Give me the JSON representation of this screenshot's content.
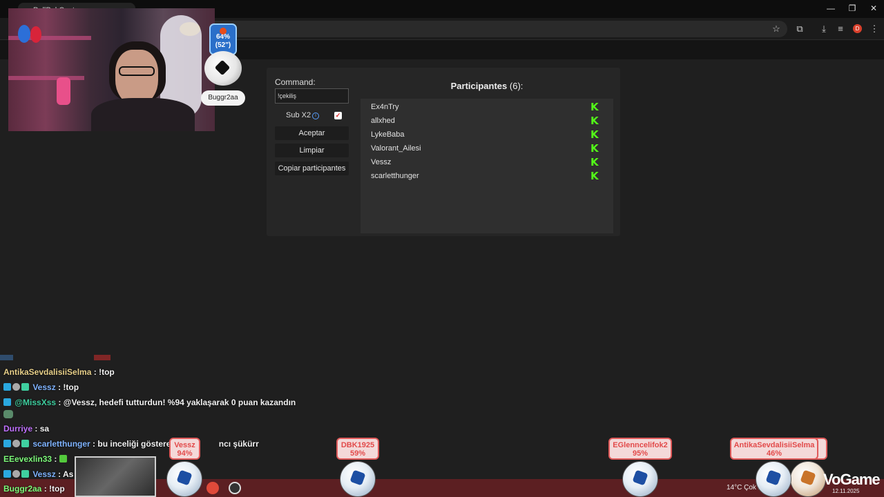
{
  "browser": {
    "tab_title": "PollPal Custom",
    "profile_initial": "D"
  },
  "overlay": {
    "ball_percent": "64%",
    "ball_time": "(52\")",
    "user_pill": "Buggr2aa"
  },
  "giveaway": {
    "command_label": "Command:",
    "command_value": "!çekiliş",
    "sub_x2_label": "Sub X2",
    "sub_x2_checked": true,
    "buttons": {
      "accept": "Aceptar",
      "clear": "Limpiar",
      "copy": "Copiar participantes"
    },
    "participants_title": "Participantes",
    "participants_count": "(6):",
    "participants": [
      "Ex4nTry",
      "allxhed",
      "LykeBaba",
      "Valorant_Ailesi",
      "Vessz",
      "scarletthunger"
    ],
    "platform_icon": "kick-icon",
    "platform_color": "#53fc18"
  },
  "chat": [
    {
      "user": "AntikaSevdalisiiSelma",
      "color": "#e8d08a",
      "text": ": !top"
    },
    {
      "user": "Vessz",
      "color": "#7fb3ff",
      "text": ": !top"
    },
    {
      "user": "@MissXss",
      "color": "#3fd0a0",
      "text": ": @Vessz, hedefi tutturdun! %94 yaklaşarak 0 puan kazandın"
    },
    {
      "user": "Durriye",
      "color": "#c070ff",
      "text": ": sa"
    },
    {
      "user": "scarletthunger",
      "color": "#7fb3ff",
      "text": ": bu inceliği gösteren",
      "tail": "ncı şükürr"
    },
    {
      "user": "EEevexlin33",
      "color": "#7dfc7a",
      "text": ":"
    },
    {
      "user": "Vessz",
      "color": "#7fb3ff",
      "text": ": As",
      "tail": "ng"
    },
    {
      "user": "Buggr2aa",
      "color": "#7dfc7a",
      "text": ": !top"
    }
  ],
  "balls": [
    {
      "name": "Vessz",
      "pct": "94%"
    },
    {
      "name": "DBK1925",
      "pct": "59%"
    },
    {
      "name": "EGlenncelifok2",
      "pct": "95%"
    },
    {
      "name": "AntikaSevdalisiiSelma",
      "pct": "46%"
    }
  ],
  "taskbar": {
    "weather": "14°C  Çok b",
    "date": "12.11.2025",
    "brand": "VoGame"
  }
}
